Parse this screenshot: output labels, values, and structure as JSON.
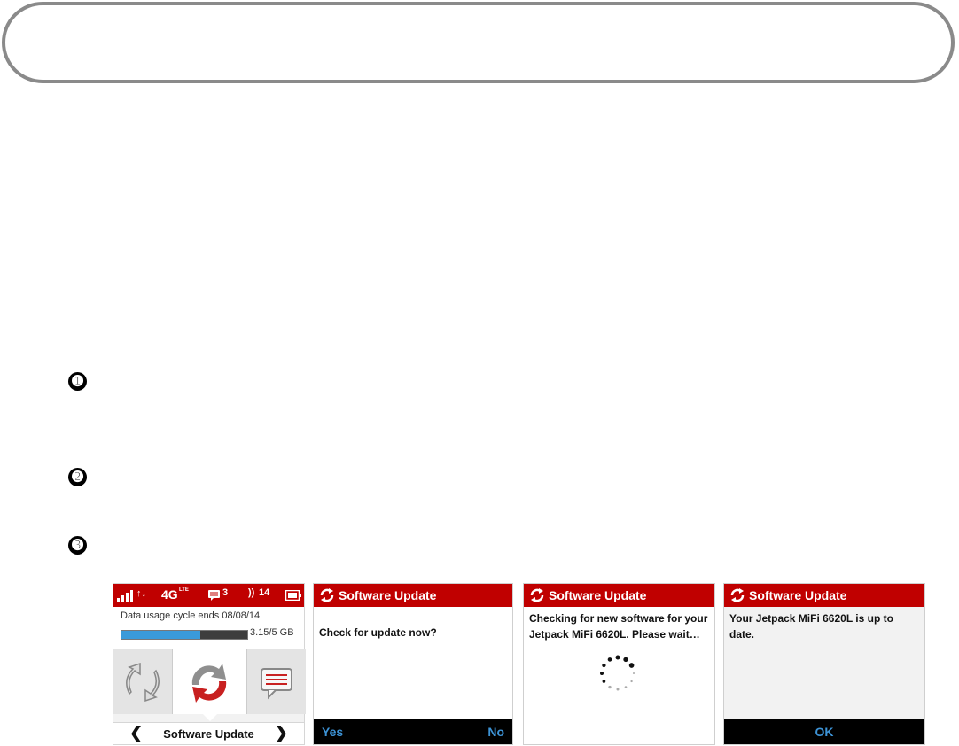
{
  "steps": [
    "➊",
    "➋",
    "➌"
  ],
  "screen1": {
    "network": "4G",
    "network_sub": "LTE",
    "messages_count": "3",
    "connected_count": "14",
    "usage_text": "Data usage cycle ends 08/08/14",
    "usage_amount": "3.15/5 GB",
    "usage_fraction": 0.63,
    "nav_prev": "❮",
    "nav_label": "Software Update",
    "nav_next": "❯",
    "icons": [
      "signal-icon",
      "data-arrows-icon",
      "messages-icon",
      "connected-devices-icon",
      "battery-icon",
      "wifi-sync-icon",
      "software-update-icon",
      "messages-tile-icon"
    ],
    "colors": {
      "header": "#c00000",
      "usage_fill": "#3a9ad9"
    }
  },
  "screen2": {
    "title": "Software Update",
    "message": "Check for update now?",
    "yes": "Yes",
    "no": "No"
  },
  "screen3": {
    "title": "Software Update",
    "message": "Checking for new software for your Jetpack MiFi 6620L. Please wait…"
  },
  "screen4": {
    "title": "Software Update",
    "message": "Your Jetpack MiFi 6620L is up to date.",
    "ok": "OK"
  }
}
